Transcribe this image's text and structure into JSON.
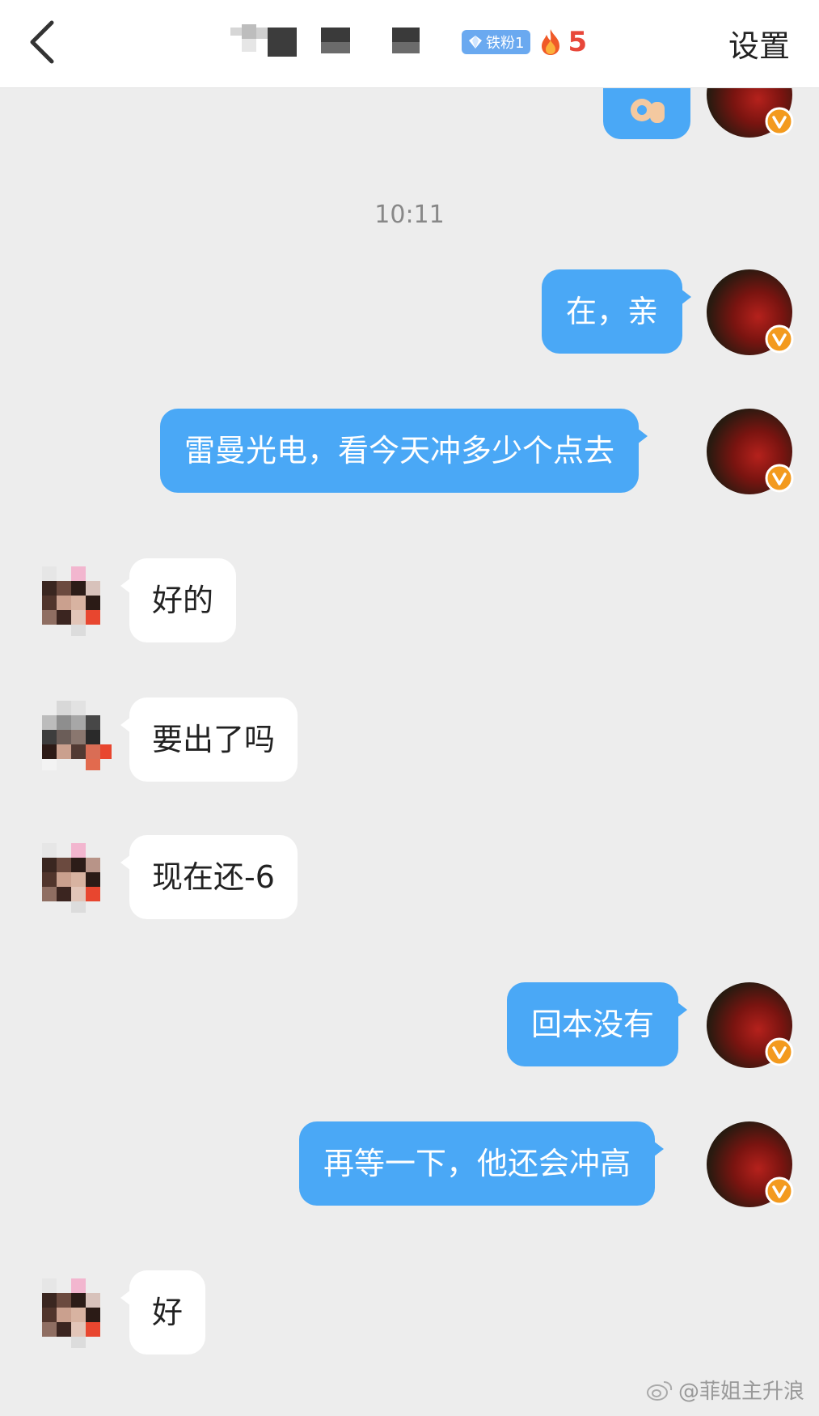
{
  "header": {
    "settings_label": "设置",
    "fan_badge": "铁粉1",
    "streak_count": "5"
  },
  "timestamp": "10:11",
  "messages": [
    {
      "side": "out",
      "text": "在，亲"
    },
    {
      "side": "out",
      "text": "雷曼光电，看今天冲多少个点去"
    },
    {
      "side": "in",
      "text": "好的"
    },
    {
      "side": "in",
      "text": "要出了吗"
    },
    {
      "side": "in",
      "text": "现在还-6"
    },
    {
      "side": "out",
      "text": "回本没有"
    },
    {
      "side": "out",
      "text": "再等一下，他还会冲高"
    },
    {
      "side": "in",
      "text": "好"
    }
  ],
  "watermark": "@菲姐主升浪",
  "colors": {
    "outgoing_bubble": "#4aa8f6",
    "incoming_bubble": "#ffffff",
    "background": "#ededed",
    "verified_badge": "#f39a1e"
  }
}
